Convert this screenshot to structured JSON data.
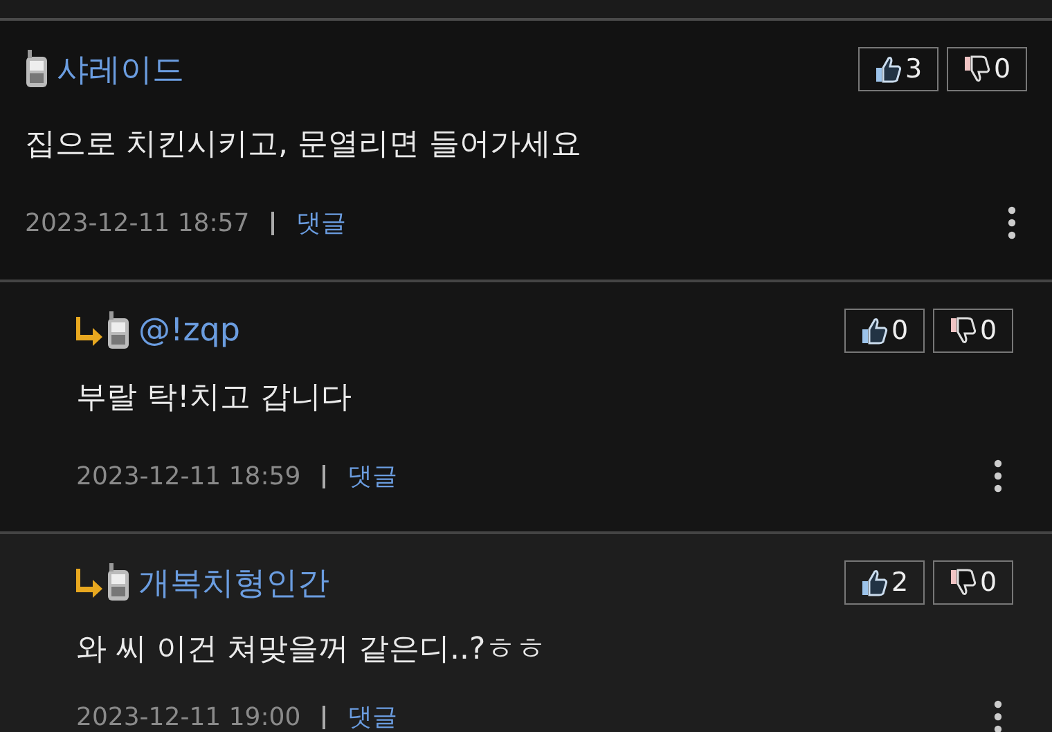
{
  "comments": [
    {
      "kind": "comment",
      "highlighted": false,
      "author": "샤레이드",
      "text": "집으로 치킨시키고, 문열리면 들어가세요",
      "date": "2023-12-11 18:57",
      "reply_link": "댓글",
      "likes": "3",
      "dislikes": "0"
    },
    {
      "kind": "reply",
      "highlighted": false,
      "author": "@!zqp",
      "text": "부랄 탁!치고 갑니다",
      "date": "2023-12-11 18:59",
      "reply_link": "댓글",
      "likes": "0",
      "dislikes": "0"
    },
    {
      "kind": "reply",
      "highlighted": true,
      "author": "개복치형인간",
      "text": "와 씨 이건 쳐맞을꺼 같은디..?ㅎㅎ",
      "date": "2023-12-11 19:00",
      "reply_link": "댓글",
      "likes": "2",
      "dislikes": "0"
    }
  ]
}
